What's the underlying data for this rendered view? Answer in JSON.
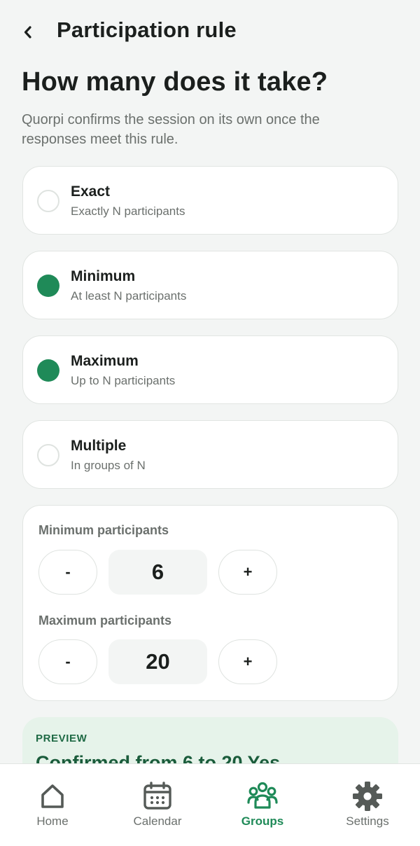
{
  "header": {
    "title": "Participation rule",
    "back_icon": "chevron-left-icon"
  },
  "main": {
    "heading": "How many does it take?",
    "subtext": "Quorpi confirms the session on its own once the responses meet this rule."
  },
  "options": [
    {
      "title": "Exact",
      "subtitle": "Exactly N participants",
      "selected": false
    },
    {
      "title": "Minimum",
      "subtitle": "At least N participants",
      "selected": true
    },
    {
      "title": "Maximum",
      "subtitle": "Up to N participants",
      "selected": true
    },
    {
      "title": "Multiple",
      "subtitle": "In groups of N",
      "selected": false
    }
  ],
  "counters": {
    "min": {
      "label": "Minimum participants",
      "value": "6",
      "decrement_label": "-",
      "increment_label": "+"
    },
    "max": {
      "label": "Maximum participants",
      "value": "20",
      "decrement_label": "-",
      "increment_label": "+"
    }
  },
  "preview": {
    "label": "PREVIEW",
    "text": "Confirmed from 6 to 20 Yes"
  },
  "nav": {
    "items": [
      {
        "label": "Home",
        "icon": "home-icon",
        "active": false
      },
      {
        "label": "Calendar",
        "icon": "calendar-icon",
        "active": false
      },
      {
        "label": "Groups",
        "icon": "groups-icon",
        "active": true
      },
      {
        "label": "Settings",
        "icon": "gear-icon",
        "active": false
      }
    ]
  },
  "colors": {
    "accent": "#1f8a58",
    "background": "#f3f5f4",
    "card": "#ffffff",
    "preview_bg": "#e6f3ea",
    "muted_text": "#6b706d",
    "nav_icon": "#555a57"
  }
}
